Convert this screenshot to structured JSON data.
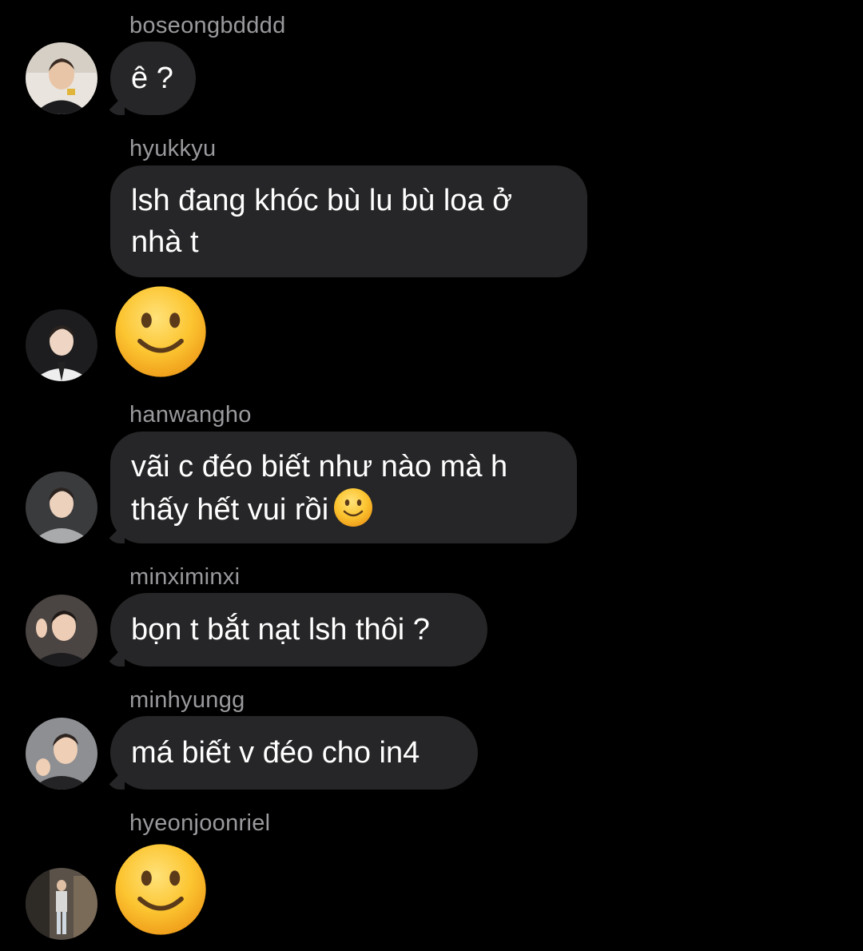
{
  "messages": [
    {
      "username": "boseongbdddd",
      "text": "ê ?",
      "avatar": "person-photo"
    },
    {
      "username": "hyukkyu",
      "lines": [
        "lsh đang khóc bù lu bù loa ở",
        "nhà t"
      ],
      "avatar": "none"
    },
    {
      "emoji": "slightly-smiling-face-emoji",
      "avatar": "person-photo"
    },
    {
      "username": "hanwangho",
      "lines": [
        "vãi c đéo biết như nào mà h",
        "thấy hết vui rồi"
      ],
      "inline_emoji": "slightly-smiling-face-emoji",
      "avatar": "person-photo"
    },
    {
      "username": "minximinxi",
      "text": "bọn t bắt nạt lsh thôi ?",
      "avatar": "person-photo"
    },
    {
      "username": "minhyungg",
      "text": "má biết v đéo cho in4",
      "avatar": "person-photo"
    },
    {
      "username": "hyeonjoonriel",
      "emoji": "slightly-smiling-face-emoji",
      "avatar": "person-photo"
    }
  ],
  "colors": {
    "background": "#000000",
    "bubble": "#262628",
    "username": "#9a9a9e",
    "text": "#ffffff",
    "emoji_face": "#f7c02b"
  }
}
